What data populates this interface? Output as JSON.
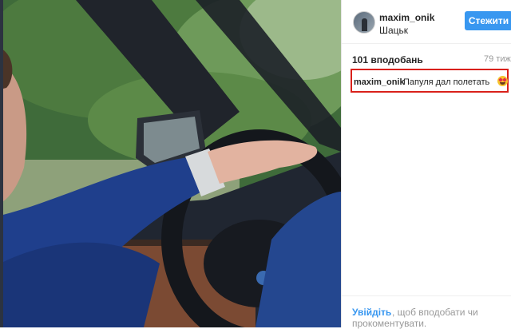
{
  "post": {
    "username": "maxim_onik",
    "location": "Шацьк",
    "follow_label": "Стежити",
    "likes": "101 вподобань",
    "time": "79 тиж"
  },
  "comment": {
    "username": "maxim_onik",
    "text": "Папуля дал полетать",
    "emoji": "heart-eyes-emoji"
  },
  "footer": {
    "login_link": "Увійдіть",
    "text_part1": ", щоб вподобати чи",
    "text_part2": "прокоментувати."
  },
  "colors": {
    "accent": "#3897f0",
    "highlight_border": "#d9211b"
  }
}
